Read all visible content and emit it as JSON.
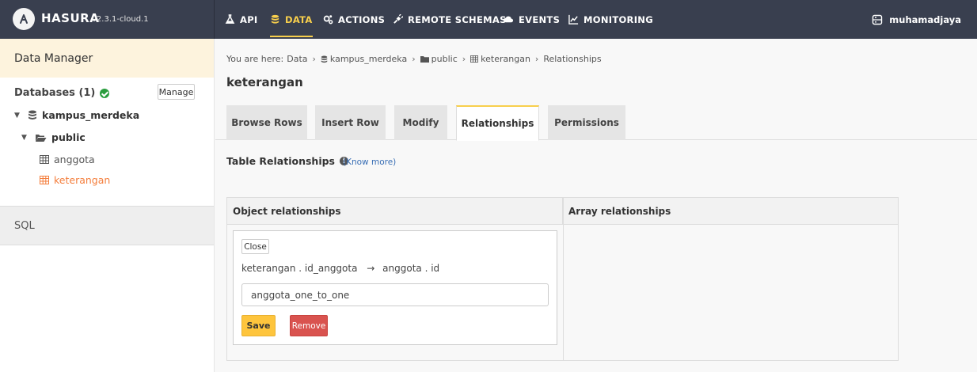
{
  "brand": {
    "name": "HASURA",
    "version": "v2.3.1-cloud.1"
  },
  "nav": {
    "items": [
      {
        "label": "API",
        "icon": "flask-icon"
      },
      {
        "label": "DATA",
        "icon": "database-icon",
        "active": true
      },
      {
        "label": "ACTIONS",
        "icon": "cogs-icon"
      },
      {
        "label": "REMOTE SCHEMAS",
        "icon": "plug-icon"
      },
      {
        "label": "EVENTS",
        "icon": "cloud-icon"
      },
      {
        "label": "MONITORING",
        "icon": "line-chart-icon"
      }
    ],
    "user": "muhamadjaya"
  },
  "colors": {
    "topbar": "#393f4f",
    "accent": "#f8cf4c",
    "active_table": "#f47e3c",
    "save": "#fec53d",
    "remove": "#d9534f"
  },
  "sidebar": {
    "title": "Data Manager",
    "databases_label": "Databases (1)",
    "manage_label": "Manage",
    "database": "kampus_merdeka",
    "schema": "public",
    "tables": [
      "anggota",
      "keterangan"
    ],
    "sql_label": "SQL"
  },
  "breadcrumb": {
    "prefix": "You are here:",
    "data": "Data",
    "database": "kampus_merdeka",
    "schema": "public",
    "table": "keterangan",
    "current": "Relationships"
  },
  "page": {
    "title": "keterangan"
  },
  "tabs": [
    "Browse Rows",
    "Insert Row",
    "Modify",
    "Relationships",
    "Permissions"
  ],
  "relationships": {
    "section_title": "Table Relationships",
    "know_more": "(Know more)",
    "object_header": "Object relationships",
    "array_header": "Array relationships",
    "close_label": "Close",
    "mapping_from": "keterangan . id_anggota",
    "mapping_arrow": "→",
    "mapping_to": "anggota . id",
    "name_value": "anggota_one_to_one",
    "save_label": "Save",
    "remove_label": "Remove"
  }
}
